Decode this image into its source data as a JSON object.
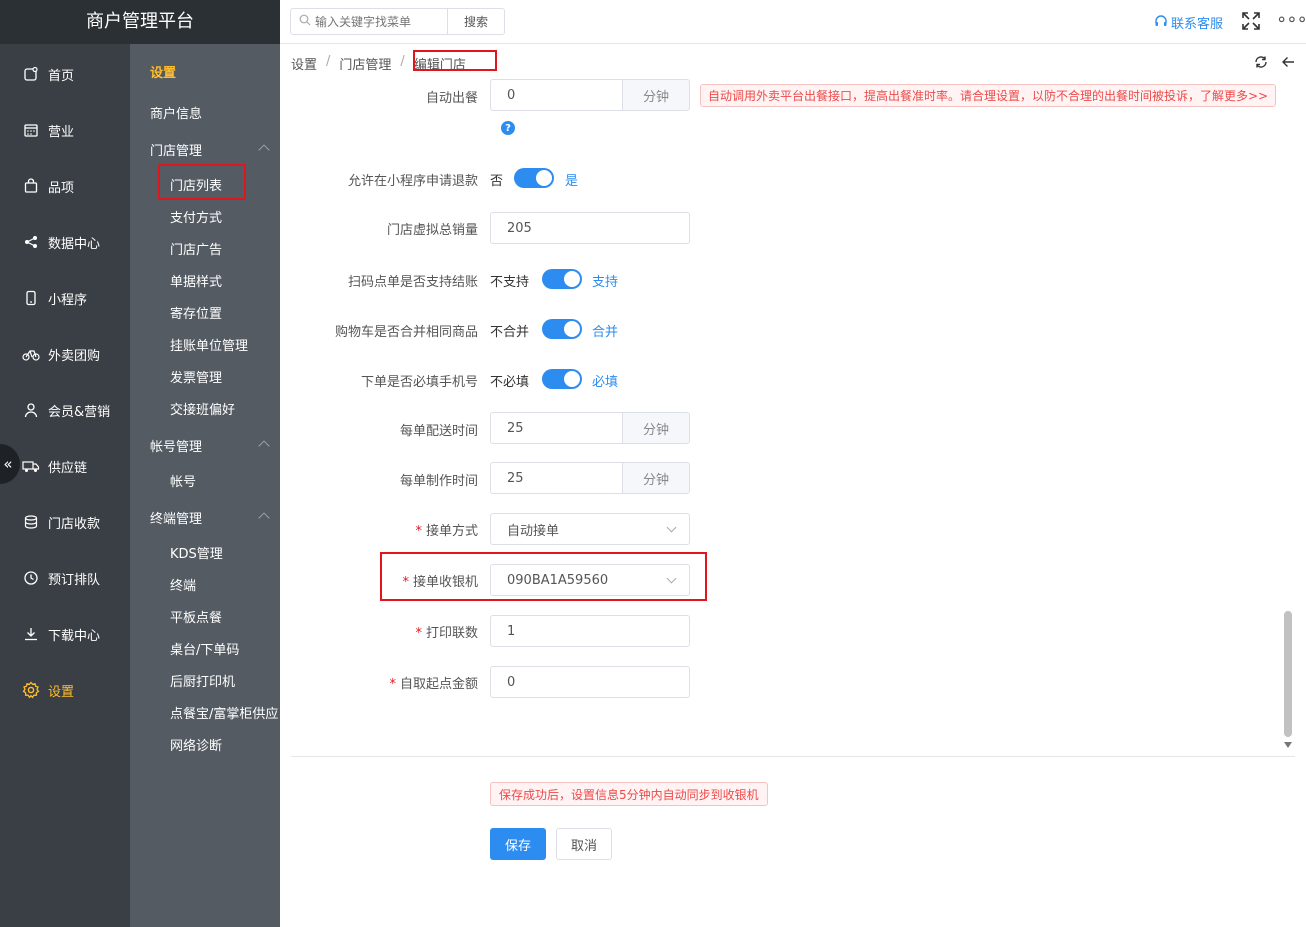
{
  "app": {
    "title": "商户管理平台"
  },
  "sidebar": {
    "items": [
      {
        "label": "首页",
        "icon": "home-icon"
      },
      {
        "label": "营业",
        "icon": "calendar-icon"
      },
      {
        "label": "品项",
        "icon": "bag-icon"
      },
      {
        "label": "数据中心",
        "icon": "share-icon"
      },
      {
        "label": "小程序",
        "icon": "phone-icon"
      },
      {
        "label": "外卖团购",
        "icon": "bike-icon"
      },
      {
        "label": "会员&营销",
        "icon": "user-icon"
      },
      {
        "label": "供应链",
        "icon": "truck-icon"
      },
      {
        "label": "门店收款",
        "icon": "coins-icon"
      },
      {
        "label": "预订排队",
        "icon": "clock-icon"
      },
      {
        "label": "下载中心",
        "icon": "download-icon"
      },
      {
        "label": "设置",
        "icon": "gear-icon",
        "active": true
      }
    ]
  },
  "submenu": {
    "title": "设置",
    "merchant_info": "商户信息",
    "store_group": "门店管理",
    "store_items": [
      "门店列表",
      "支付方式",
      "门店广告",
      "单据样式",
      "寄存位置",
      "挂账单位管理",
      "发票管理",
      "交接班偏好"
    ],
    "account_group": "帐号管理",
    "account_items": [
      "帐号"
    ],
    "terminal_group": "终端管理",
    "terminal_items": [
      "KDS管理",
      "终端",
      "平板点餐",
      "桌台/下单码",
      "后厨打印机",
      "点餐宝/富掌柜供应",
      "网络诊断"
    ]
  },
  "topbar": {
    "search_placeholder": "输入关键字找菜单",
    "search_button": "搜索",
    "support": "联系客服"
  },
  "breadcrumb": [
    "设置",
    "门店管理",
    "编辑门店"
  ],
  "form": {
    "auto_out": {
      "label": "自动出餐",
      "value": "0",
      "unit": "分钟",
      "warning": "自动调用外卖平台出餐接口，提高出餐准时率。请合理设置，以防不合理的出餐时间被投诉，了解更多>>"
    },
    "refund": {
      "label": "允许在小程序申请退款",
      "off": "否",
      "on": "是"
    },
    "virtual_sales": {
      "label": "门店虚拟总销量",
      "value": "205"
    },
    "scan_checkout": {
      "label": "扫码点单是否支持结账",
      "off": "不支持",
      "on": "支持"
    },
    "merge_cart": {
      "label": "购物车是否合并相同商品",
      "off": "不合并",
      "on": "合并"
    },
    "require_phone": {
      "label": "下单是否必填手机号",
      "off": "不必填",
      "on": "必填"
    },
    "delivery_time": {
      "label": "每单配送时间",
      "value": "25",
      "unit": "分钟"
    },
    "make_time": {
      "label": "每单制作时间",
      "value": "25",
      "unit": "分钟"
    },
    "accept_mode": {
      "label": "接单方式",
      "value": "自动接单"
    },
    "accept_cashier": {
      "label": "接单收银机",
      "value": "090BA1A59560"
    },
    "print_copies": {
      "label": "打印联数",
      "value": "1"
    },
    "pickup_min": {
      "label": "自取起点金额",
      "value": "0"
    }
  },
  "footer": {
    "notice": "保存成功后，设置信息5分钟内自动同步到收银机",
    "save": "保存",
    "cancel": "取消"
  },
  "colors": {
    "accent": "#2d8cf0",
    "active_nav": "#ffbe2e",
    "highlight": "#e0161d"
  }
}
